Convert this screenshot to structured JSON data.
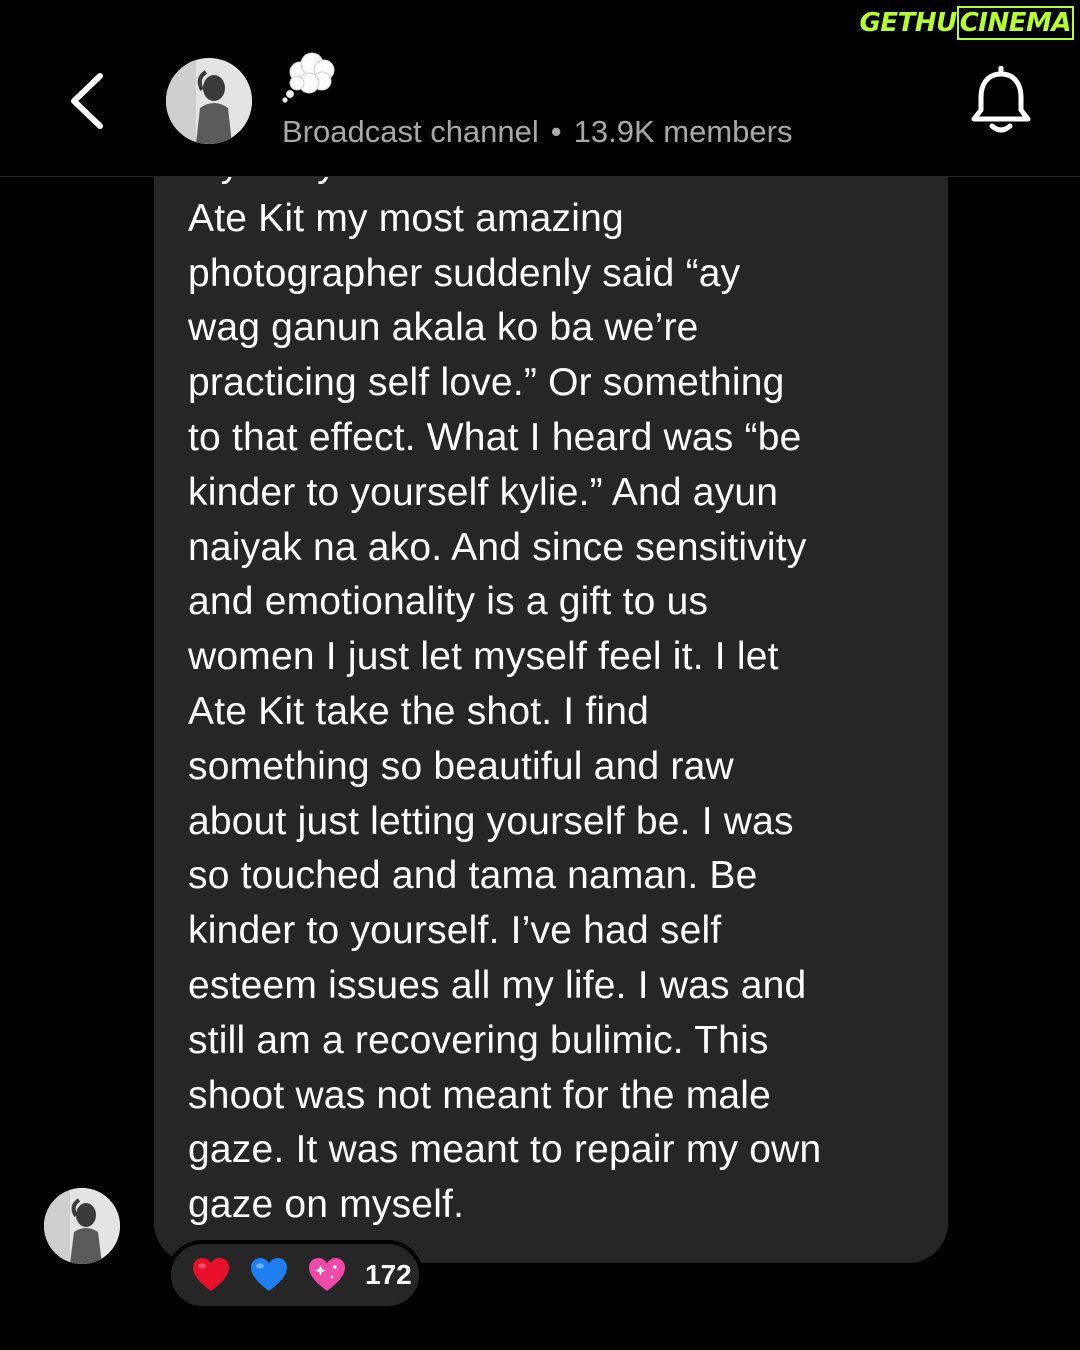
{
  "watermark": {
    "part1": "GETHU",
    "part2": "CINEMA"
  },
  "header": {
    "back_icon": "chevron-left-icon",
    "channel_name_icon": "thought-bubble-icon",
    "channel_type": "Broadcast channel",
    "separator": "•",
    "members": "13.9K members",
    "bell_icon": "bell-icon"
  },
  "message": {
    "text": "my body because of how it looked.\nAte Kit my most amazing\nphotographer suddenly said “ay\nwag ganun akala ko ba we’re\npracticing self love.” Or something\nto that effect. What I heard was “be\nkinder to yourself kylie.” And ayun\nnaiyak na ako. And since sensitivity\nand emotionality is a gift to us\nwomen I just let myself feel it. I let\nAte Kit take the shot. I find\nsomething so beautiful and raw\nabout just letting yourself be. I was\nso touched and tama naman. Be\nkinder to yourself. I’ve had self\nesteem issues all my life. I was and\nstill am a recovering bulimic. This\nshoot was not meant for the male\ngaze. It was meant to repair my own\ngaze on myself."
  },
  "reactions": {
    "items": [
      {
        "icon": "red-heart-icon",
        "color": "#e8102a"
      },
      {
        "icon": "blue-heart-icon",
        "color": "#1f7ff0"
      },
      {
        "icon": "sparkling-heart-icon",
        "color": "#f04aa8"
      }
    ],
    "count": "172"
  },
  "colors": {
    "background": "#000000",
    "bubble": "#262626",
    "secondary_text": "#a8a8a8",
    "watermark": "#b6ff2e"
  }
}
